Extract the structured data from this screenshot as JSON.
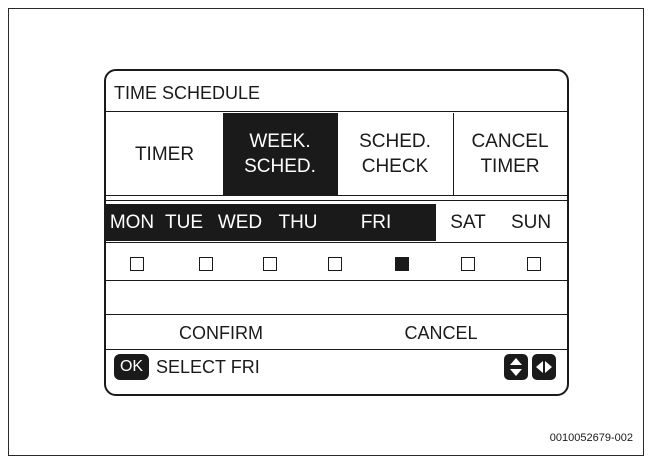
{
  "screen": {
    "title": "TIME SCHEDULE",
    "tabs": [
      {
        "label": "TIMER",
        "active": false
      },
      {
        "label": "WEEK.\nSCHED.",
        "active": true
      },
      {
        "label": "SCHED.\nCHECK",
        "active": false
      },
      {
        "label": "CANCEL\nTIMER",
        "active": false
      }
    ],
    "days": [
      {
        "label": "MON",
        "highlighted": true,
        "checked": false
      },
      {
        "label": "TUE",
        "highlighted": true,
        "checked": false
      },
      {
        "label": "WED",
        "highlighted": true,
        "checked": false
      },
      {
        "label": "THU",
        "highlighted": true,
        "checked": false
      },
      {
        "label": "FRI",
        "highlighted": true,
        "checked": true
      },
      {
        "label": "SAT",
        "highlighted": false,
        "checked": false
      },
      {
        "label": "SUN",
        "highlighted": false,
        "checked": false
      }
    ],
    "buttons": {
      "confirm": "CONFIRM",
      "cancel": "CANCEL"
    },
    "status": {
      "ok_key": "OK",
      "text": "SELECT FRI"
    },
    "nav_icons": [
      "up-down-arrow-icon",
      "left-right-arrow-icon"
    ]
  },
  "figure_code": "0010052679-002",
  "colors": {
    "ink": "#1a1a1a",
    "background": "#ffffff"
  }
}
